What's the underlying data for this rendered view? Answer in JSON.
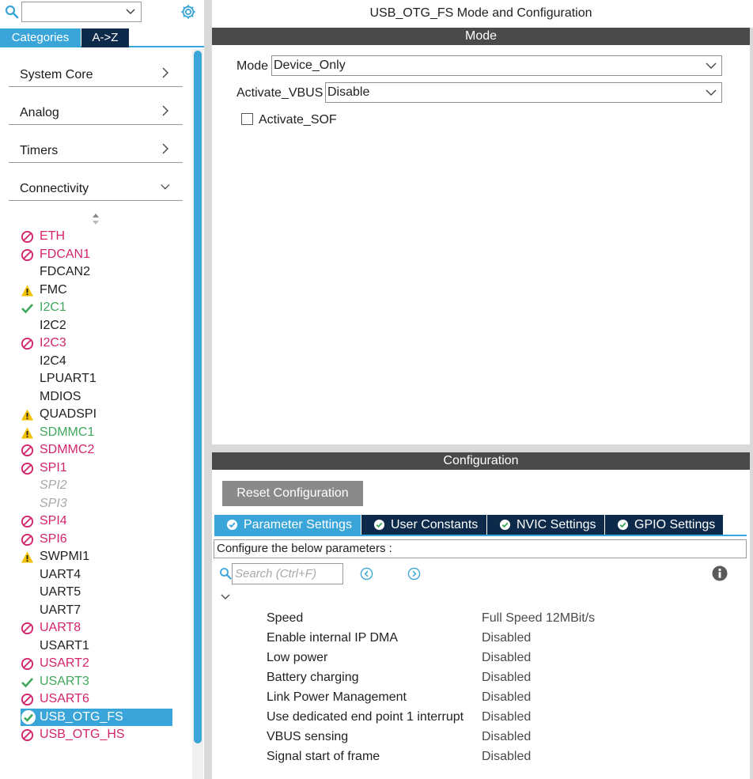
{
  "sidebar": {
    "search": {
      "value": ""
    },
    "tabs": {
      "categories": "Categories",
      "az": "A->Z"
    },
    "categories": [
      {
        "label": "System Core",
        "expanded": false
      },
      {
        "label": "Analog",
        "expanded": false
      },
      {
        "label": "Timers",
        "expanded": false
      },
      {
        "label": "Connectivity",
        "expanded": true
      }
    ],
    "items": [
      {
        "label": "ETH",
        "status": "disabled"
      },
      {
        "label": "FDCAN1",
        "status": "disabled"
      },
      {
        "label": "FDCAN2",
        "status": "none"
      },
      {
        "label": "FMC",
        "status": "warning"
      },
      {
        "label": "I2C1",
        "status": "ok"
      },
      {
        "label": "I2C2",
        "status": "none"
      },
      {
        "label": "I2C3",
        "status": "disabled"
      },
      {
        "label": "I2C4",
        "status": "none"
      },
      {
        "label": "LPUART1",
        "status": "none"
      },
      {
        "label": "MDIOS",
        "status": "none"
      },
      {
        "label": "QUADSPI",
        "status": "warning"
      },
      {
        "label": "SDMMC1",
        "status": "warning-ok"
      },
      {
        "label": "SDMMC2",
        "status": "disabled"
      },
      {
        "label": "SPI1",
        "status": "disabled"
      },
      {
        "label": "SPI2",
        "status": "unavailable"
      },
      {
        "label": "SPI3",
        "status": "unavailable"
      },
      {
        "label": "SPI4",
        "status": "disabled"
      },
      {
        "label": "SPI6",
        "status": "disabled"
      },
      {
        "label": "SWPMI1",
        "status": "warning"
      },
      {
        "label": "UART4",
        "status": "none"
      },
      {
        "label": "UART5",
        "status": "none"
      },
      {
        "label": "UART7",
        "status": "none"
      },
      {
        "label": "UART8",
        "status": "disabled"
      },
      {
        "label": "USART1",
        "status": "none"
      },
      {
        "label": "USART2",
        "status": "disabled"
      },
      {
        "label": "USART3",
        "status": "ok"
      },
      {
        "label": "USART6",
        "status": "disabled"
      },
      {
        "label": "USB_OTG_FS",
        "status": "selected"
      },
      {
        "label": "USB_OTG_HS",
        "status": "disabled"
      }
    ]
  },
  "main": {
    "title": "USB_OTG_FS Mode and Configuration",
    "mode_header": "Mode",
    "mode": {
      "label": "Mode",
      "value": "Device_Only"
    },
    "vbus": {
      "label": "Activate_VBUS",
      "value": "Disable"
    },
    "sof": {
      "label": "Activate_SOF",
      "checked": false
    },
    "config_header": "Configuration",
    "reset_label": "Reset Configuration",
    "tabs": [
      {
        "label": "Parameter Settings",
        "active": true
      },
      {
        "label": "User Constants",
        "active": false
      },
      {
        "label": "NVIC Settings",
        "active": false
      },
      {
        "label": "GPIO Settings",
        "active": false
      }
    ],
    "configure_text": "Configure the below parameters :",
    "search_placeholder": "Search (Ctrl+F)",
    "params": [
      {
        "name": "Speed",
        "value": "Full Speed 12MBit/s"
      },
      {
        "name": "Enable internal IP DMA",
        "value": "Disabled"
      },
      {
        "name": "Low power",
        "value": "Disabled"
      },
      {
        "name": "Battery charging",
        "value": "Disabled"
      },
      {
        "name": "Link Power Management",
        "value": "Disabled"
      },
      {
        "name": "Use dedicated end point 1 interrupt",
        "value": "Disabled"
      },
      {
        "name": "VBUS sensing",
        "value": "Disabled"
      },
      {
        "name": "Signal start of frame",
        "value": "Disabled"
      }
    ]
  },
  "colors": {
    "accent": "#3aa5d8",
    "dark_tab": "#0d2a4a",
    "disabled_red": "#d4246c",
    "ok_green": "#40a85c",
    "warning_yellow": "#f2c200"
  }
}
